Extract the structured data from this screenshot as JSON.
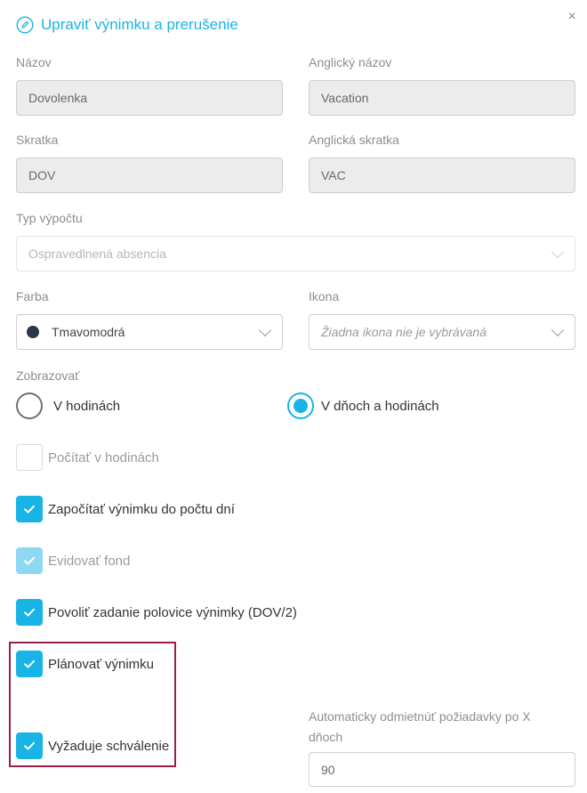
{
  "header": {
    "title": "Upraviť výnimku a prerušenie",
    "edit_icon": "pencil-circle-icon",
    "close_label": "×"
  },
  "fields": {
    "name_label": "Názov",
    "name_value": "Dovolenka",
    "english_name_label": "Anglický názov",
    "english_name_value": "Vacation",
    "abbr_label": "Skratka",
    "abbr_value": "DOV",
    "english_abbr_label": "Anglická skratka",
    "english_abbr_value": "VAC",
    "calc_type_label": "Typ výpočtu",
    "calc_type_value": "Ospravedlnená absencia",
    "color_label": "Farba",
    "color_value": "Tmavomodrá",
    "color_swatch": "#2c3648",
    "icon_label": "Ikona",
    "icon_value": "Žiadna ikona nie je vybrávaná"
  },
  "display": {
    "label": "Zobrazovať",
    "option_hours": "V hodinách",
    "option_days_hours": "V dňoch a hodinách",
    "selected": "V dňoch a hodinách"
  },
  "checkboxes": {
    "count_in_hours": "Počítať v hodinách",
    "count_in_days": "Započítať výnimku do počtu dní",
    "track_fund": "Evidovať fond",
    "allow_half": "Povoliť zadanie polovice výnimky (DOV/2)",
    "plan_exception": "Plánovať výnimku",
    "requires_approval": "Vyžaduje schválenie"
  },
  "auto_reject": {
    "label_line1": "Automaticky odmietnúť požiadavky po X",
    "label_line2": "dňoch",
    "value": "90"
  },
  "colors": {
    "accent": "#19b4e6",
    "accent_light": "#8fd8f2",
    "highlight_border": "#9b1d4b"
  }
}
